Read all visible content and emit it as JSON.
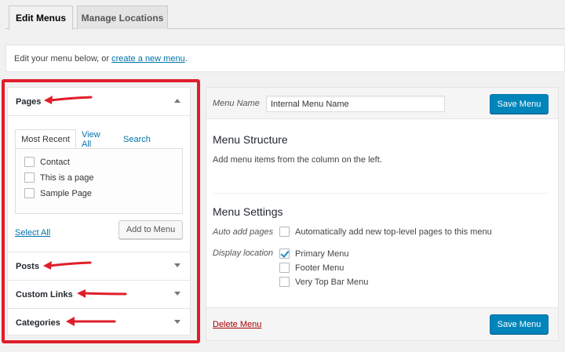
{
  "tabs": [
    {
      "label": "Edit Menus",
      "active": true
    },
    {
      "label": "Manage Locations",
      "active": false
    }
  ],
  "notice": {
    "text": "Edit your menu below, or ",
    "link": "create a new menu",
    "suffix": "."
  },
  "left": {
    "pages": {
      "title": "Pages",
      "inner_tabs": [
        "Most Recent",
        "View All",
        "Search"
      ],
      "items": [
        "Contact",
        "This is a page",
        "Sample Page"
      ],
      "select_all": "Select All",
      "add_button": "Add to Menu"
    },
    "sections": [
      "Posts",
      "Custom Links",
      "Categories"
    ]
  },
  "right": {
    "menu_name_label": "Menu Name",
    "menu_name_value": "Internal Menu Name",
    "save_label": "Save Menu",
    "structure_title": "Menu Structure",
    "structure_text": "Add menu items from the column on the left.",
    "settings_title": "Menu Settings",
    "auto_add_label": "Auto add pages",
    "auto_add_option": "Automatically add new top-level pages to this menu",
    "display_location_label": "Display location",
    "locations": [
      {
        "label": "Primary Menu",
        "checked": true
      },
      {
        "label": "Footer Menu",
        "checked": false
      },
      {
        "label": "Very Top Bar Menu",
        "checked": false
      }
    ],
    "delete_label": "Delete Menu"
  },
  "colors": {
    "highlight_red": "#e01e2a",
    "primary_blue": "#0085ba",
    "link_blue": "#0073aa",
    "delete_red": "#aa0000"
  },
  "icons": [
    "triangle-up-icon",
    "triangle-down-icon",
    "red-arrow-icon",
    "checkmark-icon"
  ]
}
